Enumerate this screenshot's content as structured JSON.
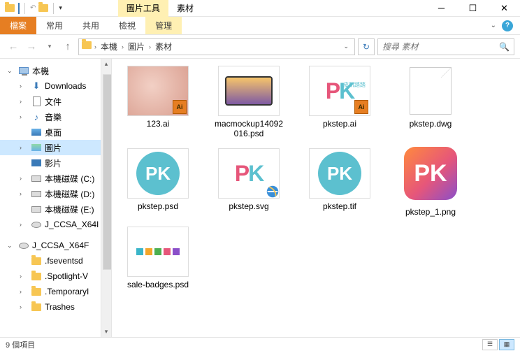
{
  "title_tabs": {
    "tools": "圖片工具",
    "context": "素材"
  },
  "window": {
    "minimize": "─",
    "maximize": "☐",
    "close": "✕"
  },
  "ribbon": {
    "file": "檔案",
    "home": "常用",
    "share": "共用",
    "view": "檢視",
    "manage": "管理"
  },
  "breadcrumb": {
    "pc": "本機",
    "pictures": "圖片",
    "folder": "素材"
  },
  "search": {
    "placeholder": "搜尋 素材"
  },
  "sidebar": {
    "pc": "本機",
    "downloads": "Downloads",
    "documents": "文件",
    "music": "音樂",
    "desktop": "桌面",
    "pictures": "圖片",
    "videos": "影片",
    "drive_c": "本機磁碟 (C:)",
    "drive_d": "本機磁碟 (D:)",
    "drive_e": "本機磁碟 (E:)",
    "jccsa1": "J_CCSA_X64I",
    "jccsa2": "J_CCSA_X64F",
    "fsevents": ".fseventsd",
    "spotlight": ".Spotlight-V",
    "temporary": ".TemporaryI",
    "trashes": "Trashes"
  },
  "files": {
    "f1": "123.ai",
    "f2": "macmockup14092016.psd",
    "f3": "pkstep.ai",
    "f4": "pkstep.dwg",
    "f5": "pkstep.psd",
    "f6": "pkstep.svg",
    "f7": "pkstep.tif",
    "f8": "pkstep_1.png",
    "f9": "sale-badges.psd"
  },
  "status": {
    "count": "9 個項目"
  },
  "pk_label": "PK",
  "pk_sub": "皮凱踏踏"
}
